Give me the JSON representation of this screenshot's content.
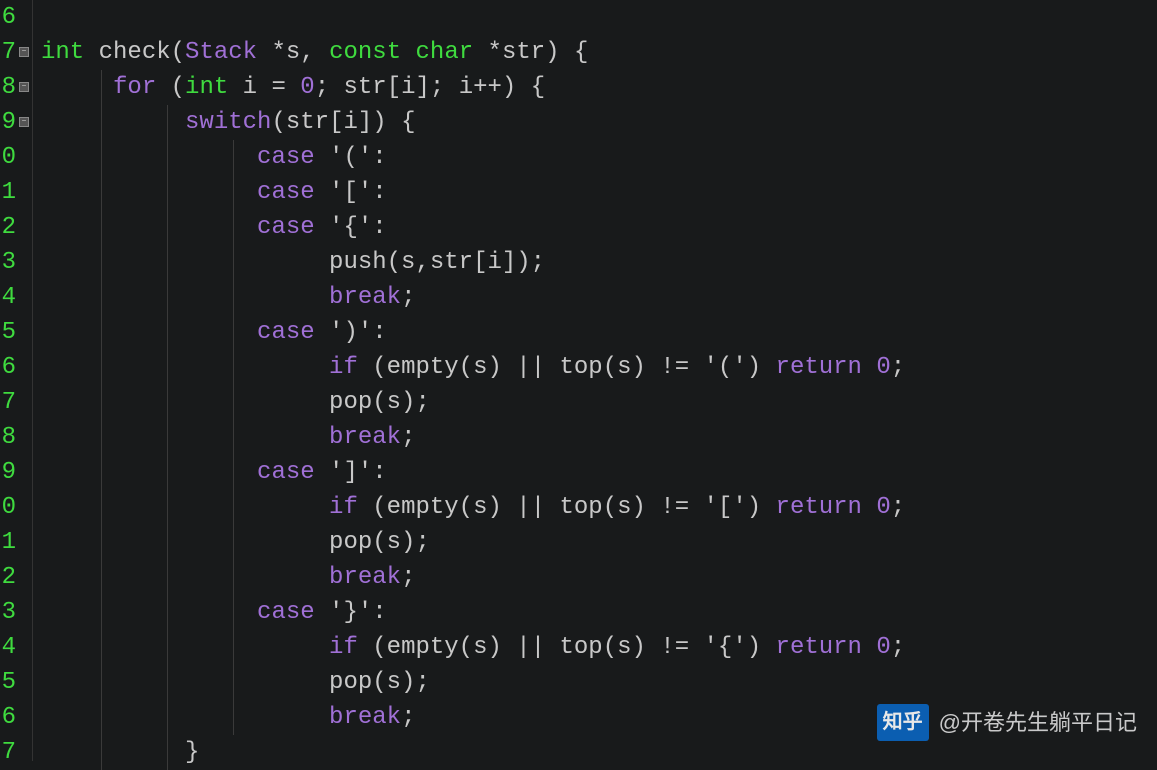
{
  "line_numbers": [
    "6",
    "7",
    "8",
    "9",
    "0",
    "1",
    "2",
    "3",
    "4",
    "5",
    "6",
    "7",
    "8",
    "9",
    "0",
    "1",
    "2",
    "3",
    "4",
    "5",
    "6",
    "7"
  ],
  "fold_markers": [
    {
      "line": 1,
      "sym": "−"
    },
    {
      "line": 2,
      "sym": "−"
    },
    {
      "line": 3,
      "sym": "−"
    }
  ],
  "code": {
    "l0": "",
    "l1_kw": "int",
    "l1_fn": " check",
    "l1_p1": "(",
    "l1_ty1": "Stack ",
    "l1_op1": "*",
    "l1_id1": "s",
    "l1_c": ", ",
    "l1_const": "const ",
    "l1_ty2": "char ",
    "l1_op2": "*",
    "l1_id2": "str",
    "l1_p2": ") {",
    "l2_for": "for",
    "l2_txt": " (",
    "l2_int": "int",
    "l2_rest": " i = ",
    "l2_zero": "0",
    "l2_semi": "; str[i]; i++) {",
    "l3_sw": "switch",
    "l3_rest": "(str[i]) {",
    "l4_case": "case",
    "l4_s": " '('",
    "l4_colon": ":",
    "l5_case": "case",
    "l5_s": " '['",
    "l5_colon": ":",
    "l6_case": "case",
    "l6_s": " '{'",
    "l6_colon": ":",
    "l7": "push(s,str[i]);",
    "l8_br": "break",
    "l8_s": ";",
    "l9_case": "case",
    "l9_s": " ')'",
    "l9_colon": ":",
    "l10_if": "if",
    "l10_a": " (empty(s) || top(s) != ",
    "l10_ch": "'('",
    "l10_b": ") ",
    "l10_ret": "return",
    "l10_c": " ",
    "l10_z": "0",
    "l10_d": ";",
    "l11": "pop(s);",
    "l12_br": "break",
    "l12_s": ";",
    "l13_case": "case",
    "l13_s": " ']'",
    "l13_colon": ":",
    "l14_if": "if",
    "l14_a": " (empty(s) || top(s) != ",
    "l14_ch": "'['",
    "l14_b": ") ",
    "l14_ret": "return",
    "l14_c": " ",
    "l14_z": "0",
    "l14_d": ";",
    "l15": "pop(s);",
    "l16_br": "break",
    "l16_s": ";",
    "l17_case": "case",
    "l17_s": " '}'",
    "l17_colon": ":",
    "l18_if": "if",
    "l18_a": " (empty(s) || top(s) != ",
    "l18_ch": "'{'",
    "l18_b": ") ",
    "l18_ret": "return",
    "l18_c": " ",
    "l18_z": "0",
    "l18_d": ";",
    "l19": "pop(s);",
    "l20_br": "break",
    "l20_s": ";",
    "l21": "}"
  },
  "watermark": {
    "logo": "知乎",
    "author": "@开卷先生躺平日记"
  }
}
